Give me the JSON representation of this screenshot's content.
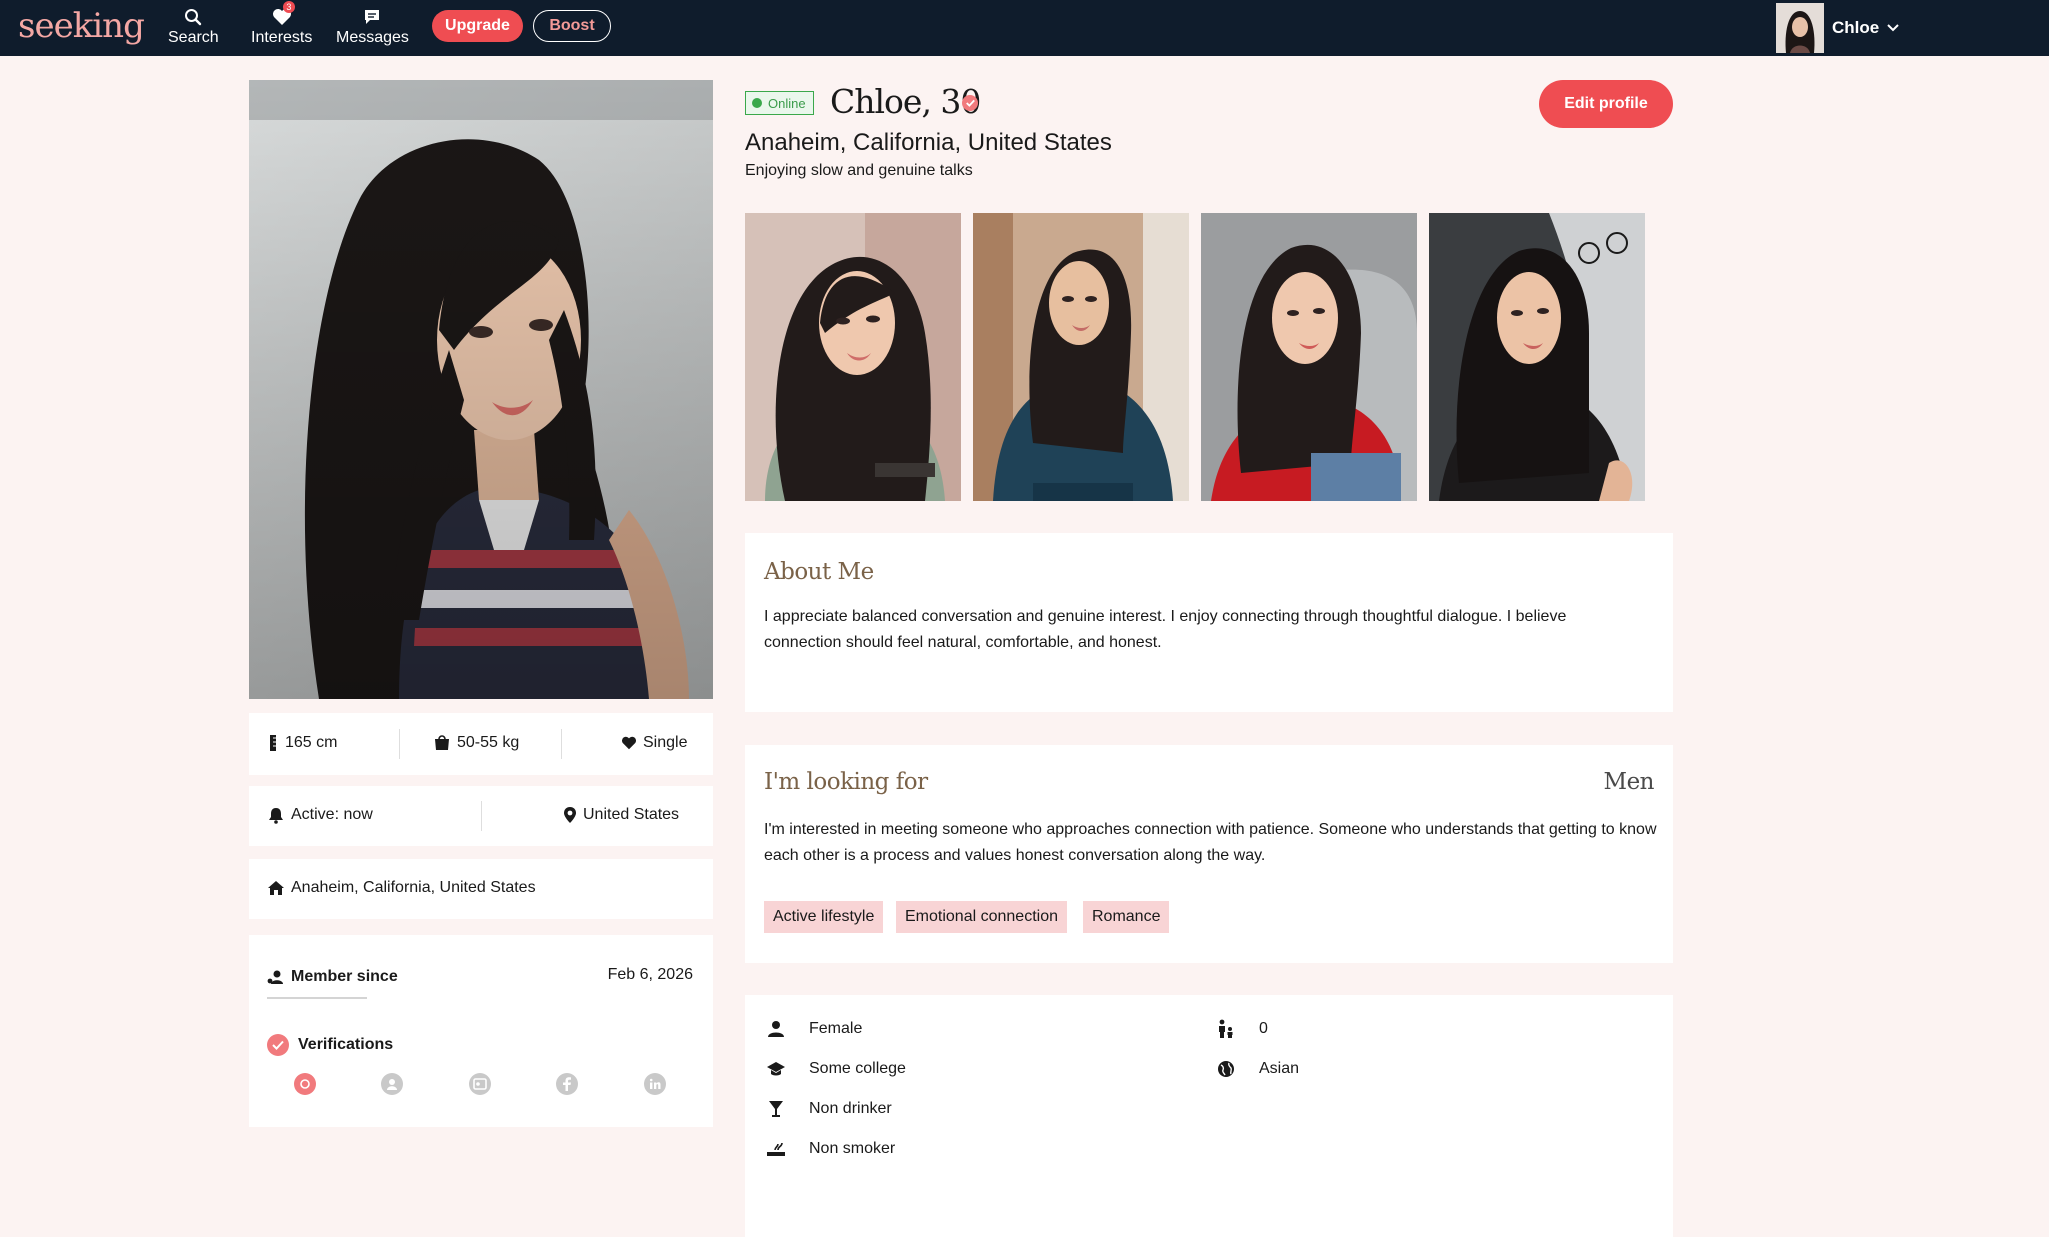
{
  "nav": {
    "logo": "seeking",
    "items": [
      {
        "label": "Search",
        "icon": "search-icon"
      },
      {
        "label": "Interests",
        "icon": "heart-icon",
        "badge": "3"
      },
      {
        "label": "Messages",
        "icon": "chat-icon"
      }
    ],
    "upgrade_label": "Upgrade",
    "boost_label": "Boost",
    "account_name": "Chloe"
  },
  "profile": {
    "status": "Online",
    "name_age": "Chloe, 30",
    "location": "Anaheim, California, United States",
    "tagline": "Enjoying slow and genuine talks",
    "edit_label": "Edit profile"
  },
  "stats": {
    "height": "165 cm",
    "weight": "50-55 kg",
    "relationship": "Single",
    "active": "Active: now",
    "country": "United States",
    "home": "Anaheim, California, United States",
    "member_since_label": "Member since",
    "member_since_date": "Feb 6, 2026",
    "verifications_label": "Verifications"
  },
  "about": {
    "title": "About Me",
    "text": "I appreciate balanced conversation and genuine interest. I enjoy connecting through thoughtful dialogue. I believe connection should feel natural, comfortable, and honest."
  },
  "looking": {
    "title": "I'm looking for",
    "target": "Men",
    "text": "I'm interested in meeting someone who approaches connection with patience. Someone who understands that getting to know each other is a process and values honest conversation along the way.",
    "tags": [
      "Active lifestyle",
      "Emotional connection",
      "Romance"
    ]
  },
  "details": {
    "gender": "Female",
    "education": "Some college",
    "drinking": "Non drinker",
    "smoking": "Non smoker",
    "children": "0",
    "ethnicity": "Asian"
  },
  "colors": {
    "nav_bg": "#0f1c2c",
    "accent": "#ef4d52",
    "page_bg": "#fcf3f2",
    "online_green": "#3aa84b",
    "tag_bg": "#f8d4d5",
    "title_brown": "#7a6248"
  }
}
